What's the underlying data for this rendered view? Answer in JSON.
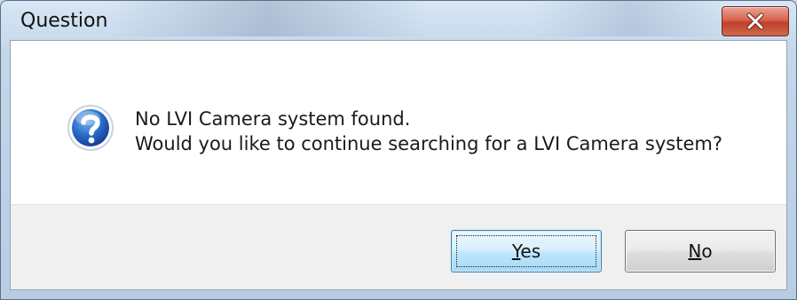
{
  "window": {
    "title": "Question"
  },
  "message": {
    "line1": "No LVI Camera system found.",
    "line2": "Would you like to continue searching for a LVI Camera system?"
  },
  "buttons": {
    "yes": {
      "mnemonic": "Y",
      "rest": "es"
    },
    "no": {
      "mnemonic": "N",
      "rest": "o"
    }
  },
  "icons": {
    "dialog": "question-icon",
    "close": "close-icon"
  },
  "colors": {
    "close_button": "#c7432e",
    "default_button_border": "#3c7fb1",
    "question_icon": "#1f5fb8"
  }
}
